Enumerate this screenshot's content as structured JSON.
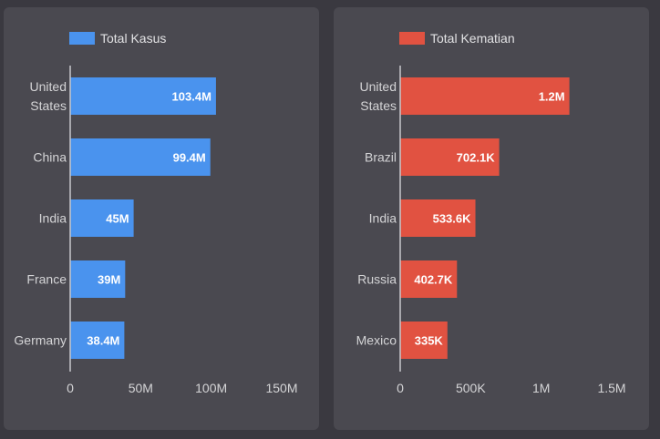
{
  "chart_data": [
    {
      "type": "bar",
      "orientation": "horizontal",
      "legend": "top-left",
      "grid": false,
      "categories": [
        [
          "United",
          "States"
        ],
        [
          "China"
        ],
        [
          "India"
        ],
        [
          "France"
        ],
        [
          "Germany"
        ]
      ],
      "series": [
        {
          "name": "Total Kasus",
          "color": "#4a93ee",
          "values": [
            103.4,
            99.4,
            45,
            39,
            38.4
          ],
          "labels": [
            "103.4M",
            "99.4M",
            "45M",
            "39M",
            "38.4M"
          ]
        }
      ],
      "xlim": [
        0,
        150
      ],
      "xticks": [
        0,
        50,
        100,
        150
      ],
      "xtick_labels": [
        "0",
        "50M",
        "100M",
        "150M"
      ]
    },
    {
      "type": "bar",
      "orientation": "horizontal",
      "legend": "top-left",
      "grid": false,
      "categories": [
        [
          "United",
          "States"
        ],
        [
          "Brazil"
        ],
        [
          "India"
        ],
        [
          "Russia"
        ],
        [
          "Mexico"
        ]
      ],
      "series": [
        {
          "name": "Total Kematian",
          "color": "#e15241",
          "values": [
            1.2,
            0.7021,
            0.5336,
            0.4027,
            0.335
          ],
          "labels": [
            "1.2M",
            "702.1K",
            "533.6K",
            "402.7K",
            "335K"
          ]
        }
      ],
      "xlim": [
        0,
        1.5
      ],
      "xticks": [
        0,
        0.5,
        1,
        1.5
      ],
      "xtick_labels": [
        "0",
        "500K",
        "1M",
        "1.5M"
      ]
    }
  ]
}
